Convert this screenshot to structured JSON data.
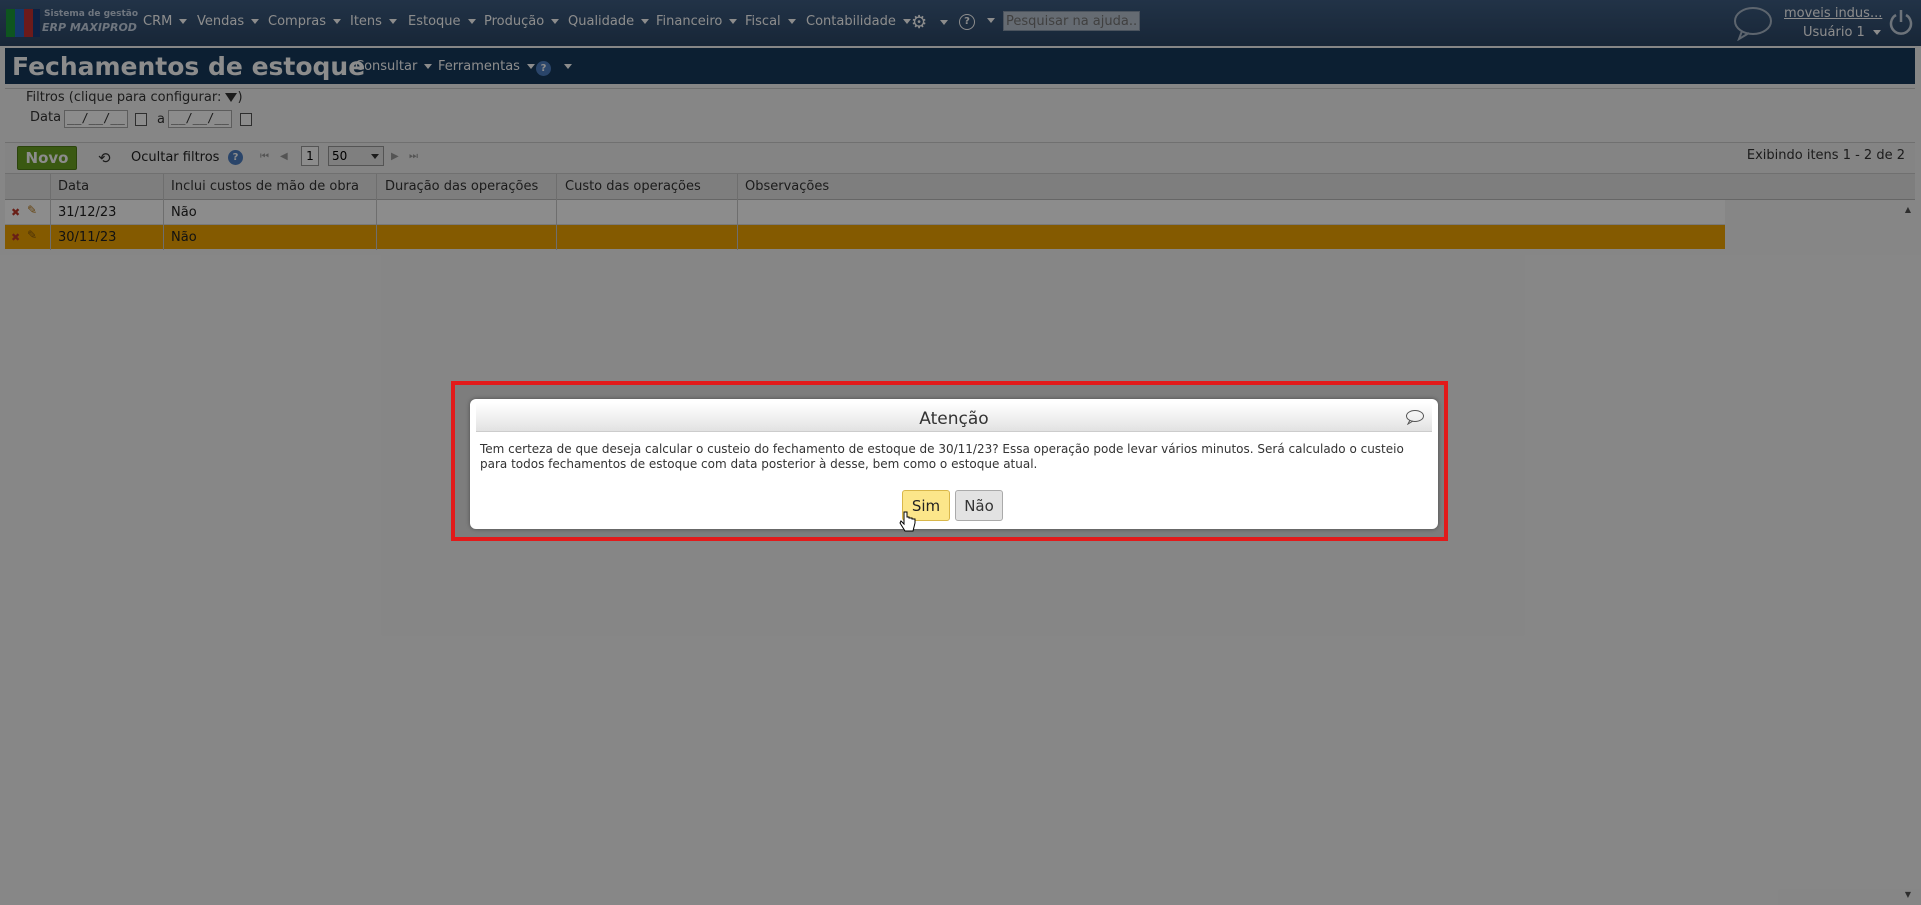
{
  "brand": {
    "line1": "Sistema de gestão",
    "line2": "ERP MAXIPROD"
  },
  "nav": [
    "CRM",
    "Vendas",
    "Compras",
    "Itens",
    "Estoque",
    "Produção",
    "Qualidade",
    "Financeiro",
    "Fiscal",
    "Contabilidade"
  ],
  "search": {
    "placeholder": "Pesquisar na ajuda..."
  },
  "user": {
    "company": "moveis indus...",
    "name": "Usuário 1"
  },
  "page": {
    "title": "Fechamentos de estoque",
    "menu_consultar": "Consultar",
    "menu_ferramentas": "Ferramentas"
  },
  "filters": {
    "legend": "Filtros (clique para configurar:",
    "legend_close": ")",
    "date_label": "Data",
    "to_label": "a",
    "date_from": "__/__/__",
    "date_to": "__/__/__"
  },
  "toolbar": {
    "new_label": "Novo",
    "hide_filters": "Ocultar filtros",
    "page": "1",
    "per_page": "50",
    "count": "Exibindo itens 1 - 2 de 2"
  },
  "grid": {
    "columns": [
      "Data",
      "Inclui custos de mão de obra",
      "Duração das operações",
      "Custo das operações",
      "Observações"
    ],
    "rows": [
      {
        "data": "31/12/23",
        "inclui": "Não"
      },
      {
        "data": "30/11/23",
        "inclui": "Não"
      }
    ]
  },
  "dialog": {
    "title": "Atenção",
    "message": "Tem certeza de que deseja calcular o custeio do fechamento de estoque de 30/11/23? Essa operação pode levar vários minutos. Será calculado o custeio para todos fechamentos de estoque com data posterior à desse, bem como o estoque atual.",
    "yes": "Sim",
    "no": "Não"
  },
  "colors": {
    "nav_bg": "#2c4665",
    "title_bg": "#173a5c",
    "new_button": "#6aa321",
    "selected_row": "#f0a500",
    "highlight_border": "#e21a1a",
    "yes_button": "#fce68a"
  }
}
